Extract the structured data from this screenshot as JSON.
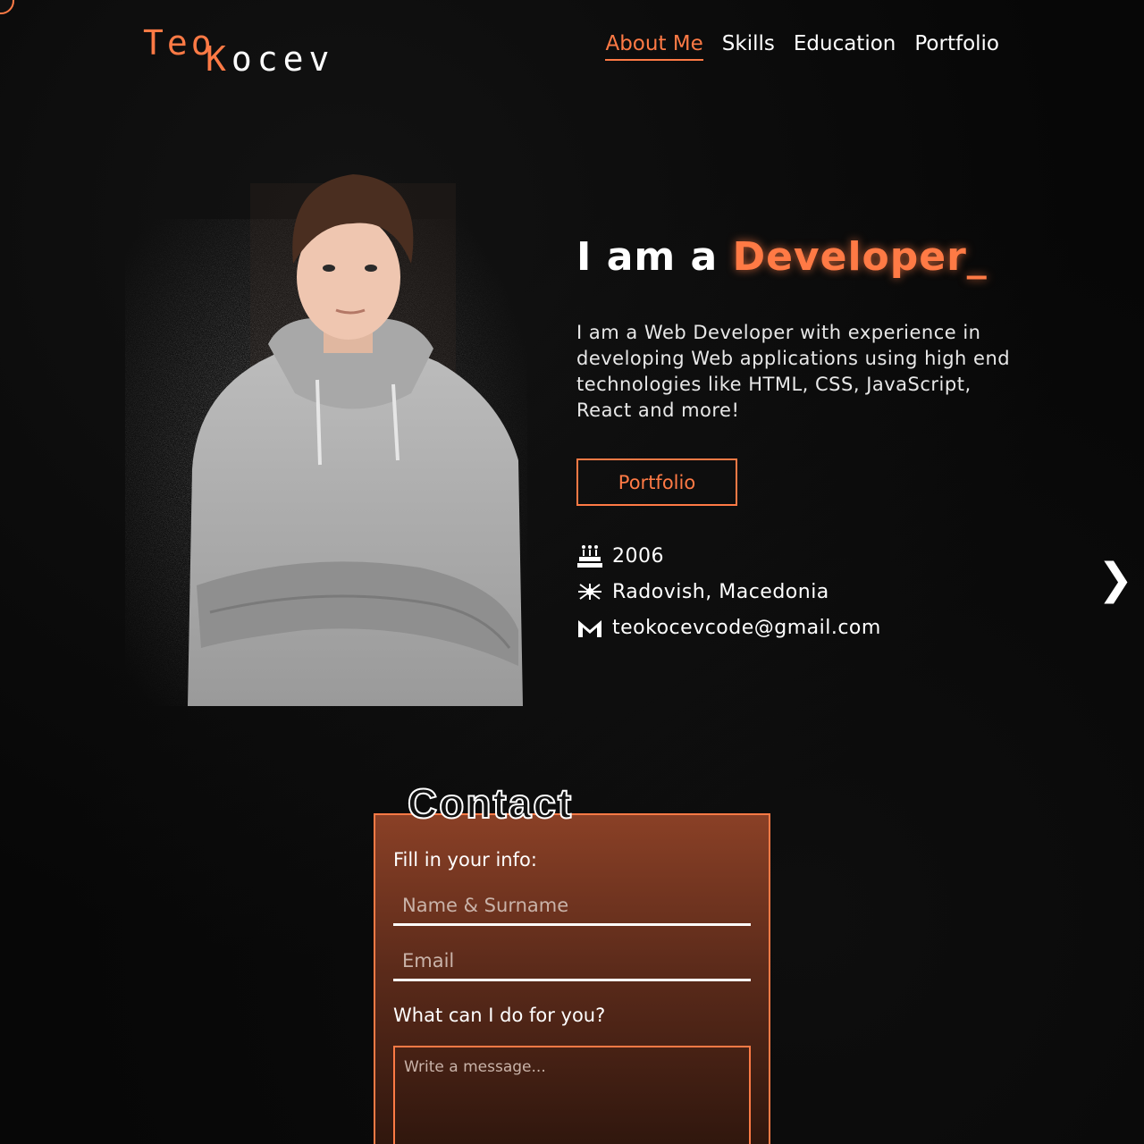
{
  "logo": {
    "first": "Teo",
    "last_k": "K",
    "last_rest": "ocev"
  },
  "nav": [
    {
      "label": "About Me",
      "active": true
    },
    {
      "label": "Skills",
      "active": false
    },
    {
      "label": "Education",
      "active": false
    },
    {
      "label": "Portfolio",
      "active": false
    }
  ],
  "hero": {
    "headline_prefix": "I am a ",
    "headline_accent": "Developer_",
    "intro": "I am a Web Developer with experience in developing Web applications using high end technologies like HTML, CSS, JavaScript, React and more!",
    "portfolio_button": "Portfolio",
    "info": [
      {
        "icon": "cake-icon",
        "text": "2006"
      },
      {
        "icon": "flag-icon",
        "text": "Radovish, Macedonia"
      },
      {
        "icon": "gmail-icon",
        "text": "teokocevcode@gmail.com"
      }
    ],
    "next_arrow": "❯"
  },
  "contact": {
    "title": "Contact",
    "fill_label": "Fill in your info:",
    "name_placeholder": "Name & Surname",
    "email_placeholder": "Email",
    "question_label": "What can I do for you?",
    "message_placeholder": "Write a message..."
  },
  "colors": {
    "accent": "#ff7a45",
    "background": "#070707",
    "text": "#ffffff"
  }
}
